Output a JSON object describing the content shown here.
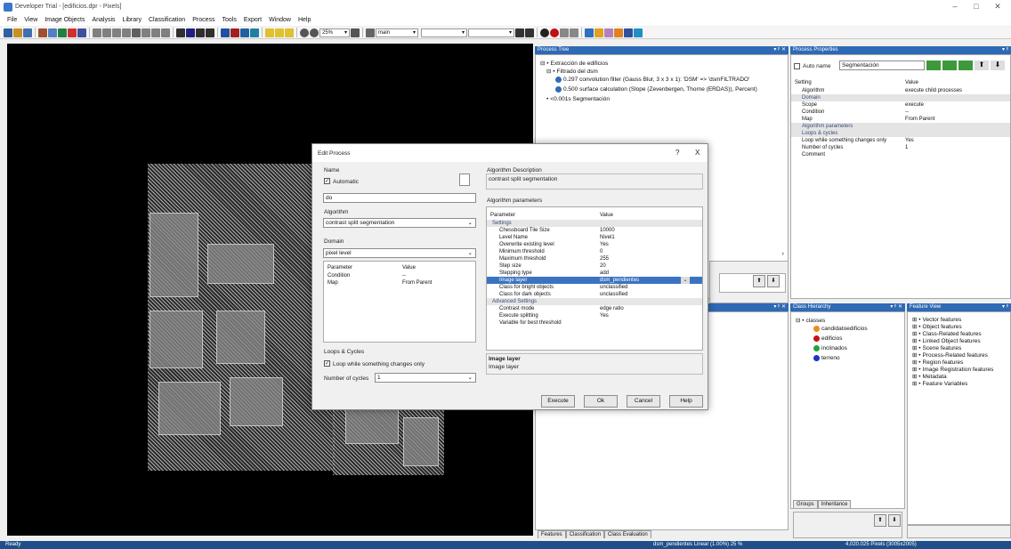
{
  "window": {
    "title": "Developer Trial - [edificios.dpr - Pixels]"
  },
  "menu": [
    "File",
    "View",
    "Image Objects",
    "Analysis",
    "Library",
    "Classification",
    "Process",
    "Tools",
    "Export",
    "Window",
    "Help"
  ],
  "toolbar": {
    "zoom": "25%",
    "layer": "main"
  },
  "process_tree": {
    "title": "Process Tree",
    "items": [
      {
        "label": "Extracción de edificios"
      },
      {
        "label": "Filtrado del dsm"
      },
      {
        "label": "0.297  convolution filter (Gauss Blur, 3 x 3 x 1): 'DSM' => 'dsmFILTRADO'"
      },
      {
        "label": "0.500  surface calculation (Slope (Zevenbergen, Thorne (ERDAS)), Percent)"
      },
      {
        "label": "<0.001s  Segmentación"
      }
    ]
  },
  "process_properties": {
    "title": "Process Properties",
    "auto_name_label": "Auto name",
    "name_value": "Segmentación",
    "header_setting": "Setting",
    "header_value": "Value",
    "rows": [
      {
        "k": "Algorithm",
        "v": "execute child processes",
        "sec": false
      },
      {
        "k": "Domain",
        "v": "",
        "sec": true
      },
      {
        "k": "Scope",
        "v": "execute",
        "sec": false
      },
      {
        "k": "Condition",
        "v": "--",
        "sec": false
      },
      {
        "k": "Map",
        "v": "From Parent",
        "sec": false
      },
      {
        "k": "Algorithm parameters",
        "v": "",
        "sec": true
      },
      {
        "k": "Loops & cycles",
        "v": "",
        "sec": true
      },
      {
        "k": "Loop while something changes only",
        "v": "Yes",
        "sec": false
      },
      {
        "k": "Number of cycles",
        "v": "1",
        "sec": false
      },
      {
        "k": "Comment",
        "v": "",
        "sec": false
      }
    ]
  },
  "class_hierarchy": {
    "title": "Class Hierarchy",
    "root": "classes",
    "classes": [
      {
        "name": "candidatoedificios",
        "color": "#f08a1c"
      },
      {
        "name": "edificios",
        "color": "#c8101c"
      },
      {
        "name": "inclinados",
        "color": "#22a23a"
      },
      {
        "name": "terreno",
        "color": "#1a34c8"
      }
    ],
    "tabs": [
      "Groups",
      "Inheritance"
    ]
  },
  "feature_view": {
    "title": "Feature View",
    "items": [
      "Vector features",
      "Object features",
      "Class-Related features",
      "Linked Object features",
      "Scene features",
      "Process-Related features",
      "Region features",
      "Image Registration features",
      "Metadata",
      "Feature Variables"
    ]
  },
  "bottom_tabs": [
    "Features",
    "Classification",
    "Class Evaluation"
  ],
  "dialog": {
    "title": "Edit Process",
    "help": "?",
    "close": "X",
    "name_label": "Name",
    "automatic_label": "Automatic",
    "name_value": "do",
    "algorithm_label": "Algorithm",
    "algorithm_value": "contrast split segmentation",
    "domain_label": "Domain",
    "domain_value": "pixel level",
    "domain_table_header": {
      "param": "Parameter",
      "value": "Value"
    },
    "domain_rows": [
      {
        "k": "Condition",
        "v": "--"
      },
      {
        "k": "Map",
        "v": "From Parent"
      }
    ],
    "loops_label": "Loops & Cycles",
    "loop_check_label": "Loop while something changes only",
    "cycles_label": "Number of cycles",
    "cycles_value": "1",
    "alg_desc_label": "Algorithm Description",
    "alg_desc_value": "contrast split segmentation",
    "alg_params_label": "Algorithm parameters",
    "params_header": {
      "param": "Parameter",
      "value": "Value"
    },
    "params": [
      {
        "k": "Settings",
        "v": "",
        "t": "sec"
      },
      {
        "k": "Chessboard Tile Size",
        "v": "10000",
        "t": ""
      },
      {
        "k": "Level Name",
        "v": "Nivel1",
        "t": ""
      },
      {
        "k": "Overwrite existing level",
        "v": "Yes",
        "t": ""
      },
      {
        "k": "Minimum threshold",
        "v": "0",
        "t": ""
      },
      {
        "k": "Maximum threshold",
        "v": "255",
        "t": ""
      },
      {
        "k": "Step size",
        "v": "20",
        "t": ""
      },
      {
        "k": "Stepping type",
        "v": "add",
        "t": ""
      },
      {
        "k": "Image layer",
        "v": "dsm_pendientes",
        "t": "sel"
      },
      {
        "k": "Class for bright objects",
        "v": "unclassified",
        "t": ""
      },
      {
        "k": "Class for dark objects",
        "v": "unclassified",
        "t": ""
      },
      {
        "k": "Advanced Settings",
        "v": "",
        "t": "sec"
      },
      {
        "k": "Contrast mode",
        "v": "edge ratio",
        "t": ""
      },
      {
        "k": "Execute splitting",
        "v": "Yes",
        "t": ""
      },
      {
        "k": "Variable for best threshold",
        "v": "",
        "t": ""
      }
    ],
    "help_title": "Image layer",
    "help_text": "Image layer",
    "buttons": {
      "execute": "Execute",
      "ok": "Ok",
      "cancel": "Cancel",
      "help": "Help"
    }
  },
  "status": {
    "left": "Ready",
    "layer_info": "dsm_pendientes   Linear (1.00%)  25 %",
    "coords": "4,020.025 Pixels (3005x2005)"
  }
}
